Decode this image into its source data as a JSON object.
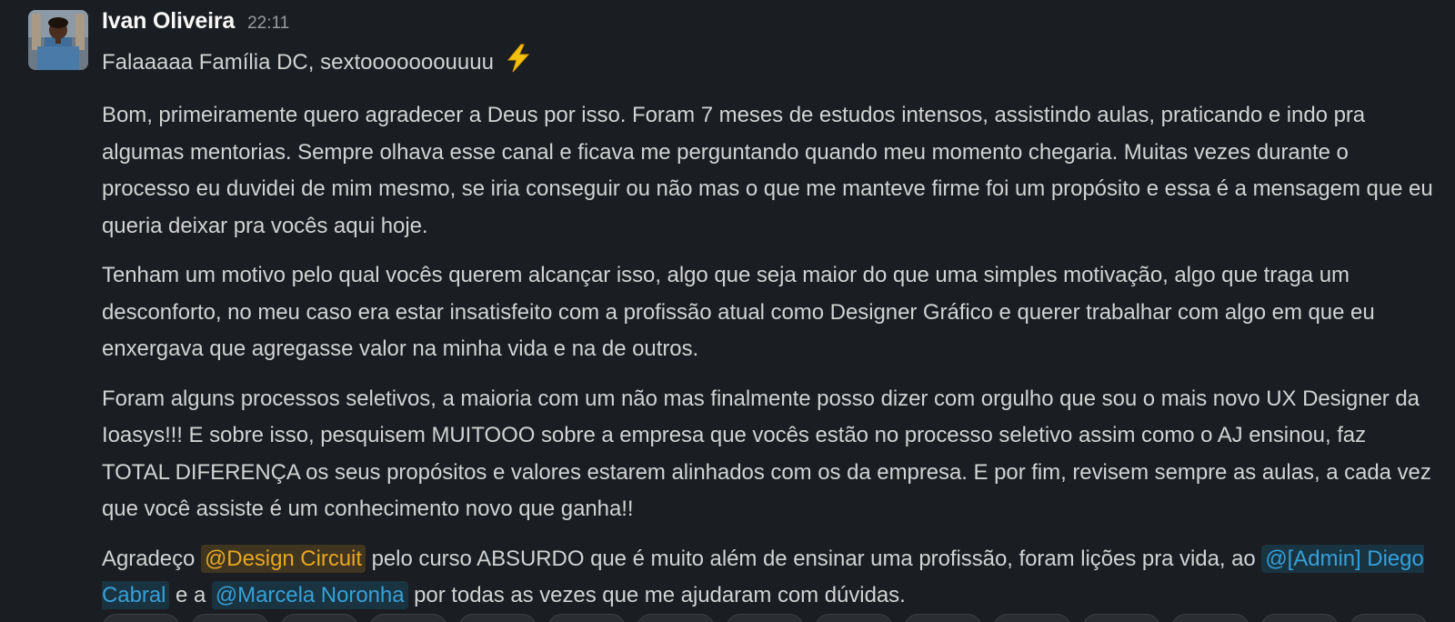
{
  "message": {
    "author": "Ivan Oliveira",
    "time": "22:11",
    "greeting": "Falaaaaa Família DC, sextooooooouuuu",
    "greeting_emoji": "zap-icon",
    "p1": "Bom, primeiramente quero agradecer a Deus por isso. Foram 7 meses de estudos intensos, assistindo aulas, praticando e indo pra algumas mentorias. Sempre olhava esse canal e ficava me perguntando quando meu momento chegaria. Muitas vezes durante o processo eu duvidei de mim mesmo, se iria conseguir ou não mas o que me manteve firme foi um propósito e essa é a mensagem que eu queria deixar pra vocês aqui hoje.",
    "p2": "Tenham um motivo pelo qual vocês querem alcançar isso, algo que seja maior do que uma simples motivação, algo que traga um desconforto, no meu caso era estar insatisfeito com a profissão atual como Designer Gráfico e querer trabalhar com algo em que eu enxergava que agregasse valor na minha vida e na de outros.",
    "p3": "Foram alguns processos seletivos, a maioria com um não mas finalmente posso dizer com orgulho que sou o mais novo UX Designer da Ioasys!!! E sobre isso, pesquisem MUITOOO sobre a empresa que vocês estão no processo seletivo assim como o AJ ensinou, faz TOTAL DIFERENÇA os seus propósitos e valores estarem alinhados com os da empresa. E por fim, revisem sempre as aulas, a cada vez que você assiste é um conhecimento novo que ganha!!",
    "p4": {
      "t1": "Agradeço ",
      "mention1": "@Design Circuit",
      "t2": " pelo curso ABSURDO que é muito além de ensinar uma profissão, foram lições pra vida, ao ",
      "mention2": "@[Admin] Diego Cabral",
      "t3": " e a ",
      "mention3": "@Marcela Noronha",
      "t4": " por todas as vezes que me ajudaram com dúvidas."
    }
  },
  "colors": {
    "background": "#1a1d21",
    "text": "#d1d2d3",
    "group_mention": "#e8a723",
    "user_mention": "#36a0d8"
  }
}
